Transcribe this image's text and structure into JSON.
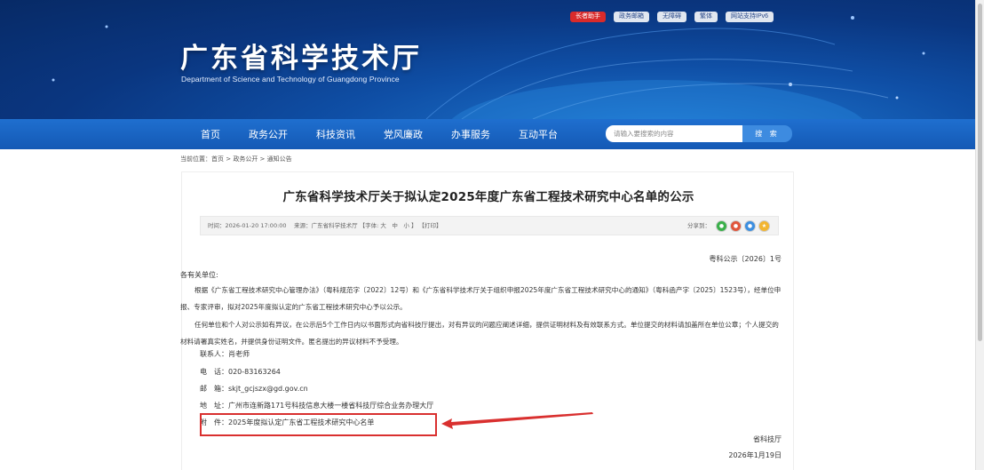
{
  "header": {
    "title": "广东省科学技术厅",
    "subtitle": "Department of Science and Technology of Guangdong Province",
    "toplinks": [
      "长者助手",
      "政务邮箱",
      "无障碍",
      "繁体",
      "网站支持IPv6"
    ]
  },
  "nav": {
    "items": [
      "首页",
      "政务公开",
      "科技资讯",
      "党风廉政",
      "办事服务",
      "互动平台"
    ],
    "search_placeholder": "请输入要搜索的内容",
    "search_button": "搜 索"
  },
  "breadcrumb": "当前位置：首页 > 政务公开 > 通知公告",
  "article": {
    "title": "广东省科学技术厅关于拟认定2025年度广东省工程技术研究中心名单的公示",
    "meta": "时间：2026-01-20 17:00:00　 来源：广东省科学技术厅 【字体: 大　中　小 】 【打印】",
    "share_label": "分享到：",
    "doc_number": "粤科公示〔2026〕1号",
    "salutation": "各有关单位:",
    "paragraphs": [
      "根据《广东省工程技术研究中心管理办法》（粤科规范字〔2022〕12号）和《广东省科学技术厅关于组织申报2025年度广东省工程技术研究中心的通知》（粤科函产字〔2025〕1523号），经单位申报、专家评审，拟对2025年度拟认定的广东省工程技术研究中心予以公示。",
      "任何单位和个人对公示如有异议，在公示后5个工作日内以书面形式向省科技厅提出，对有异议的问题应阐述详细，提供证明材料及有效联系方式。单位提交的材料请加盖所在单位公章；个人提交的材料请署真实姓名，并提供身份证明文件。匿名提出的异议材料不予受理。"
    ],
    "contacts": [
      "联系人：肖老师",
      "电　话：020-83163264",
      "邮　箱：skjt_gcjszx@gd.gov.cn",
      "地　址：广州市连新路171号科技信息大楼一楼省科技厅综合业务办理大厅"
    ],
    "attachment": "附　件：2025年度拟认定广东省工程技术研究中心名单",
    "signer": "省科技厅",
    "date": "2026年1月19日"
  },
  "colors": {
    "banner": "#0a3680",
    "nav": "#1a64c2",
    "highlight": "#d9302f"
  }
}
